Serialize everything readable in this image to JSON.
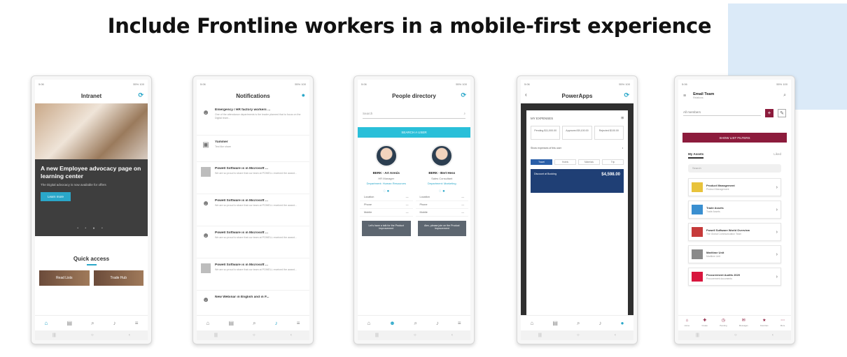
{
  "headline": "Include Frontline workers in a mobile-first experience",
  "phone1": {
    "status_time": "5:06",
    "status_right": "55% 100",
    "title": "Intranet",
    "hero_title": "A new Employee advocacy page on learning center",
    "hero_sub": "The Digital advocacy is now available for offers",
    "hero_button": "Learn more",
    "quick_access_title": "Quick access",
    "tiles": [
      "Read Lists",
      "Trade Hub"
    ]
  },
  "phone2": {
    "title": "Notifications",
    "items": [
      {
        "title": "Emergency / HR factory workers ...",
        "body": "One of the attendance departments is the leader planned that to focus on the Digital team..."
      },
      {
        "title": "Yammer",
        "body": "Test like share"
      },
      {
        "title": "Powell Software is in Microsoft ...",
        "body": "We are so proud to share that our team at POWELL received the award..."
      },
      {
        "title": "Powell Software is in Microsoft ...",
        "body": "We are so proud to share that our team at POWELL received the award..."
      },
      {
        "title": "Powell Software is in Microsoft ...",
        "body": "We are so proud to share that our team at POWELL received the award..."
      },
      {
        "title": "Powell Software is in Microsoft ...",
        "body": "We are so proud to share that our team at POWELL received the award..."
      },
      {
        "title": "New Webinar in English and in F...",
        "body": ""
      }
    ]
  },
  "phone3": {
    "title": "People directory",
    "search_placeholder": "Search",
    "bar_label": "SEARCH A USER",
    "people": [
      {
        "name": "BERK - Art Arenis",
        "role": "HR Manager",
        "link": "Department: Human Resources",
        "rows": [
          "Location",
          "Phone",
          "Mobile"
        ],
        "message": "Let's have a talk for the Product Improvement"
      },
      {
        "name": "BERK - Bert Hess",
        "role": "Sales Consultant",
        "link": "Department: Marketing",
        "rows": [
          "Location",
          "Phone",
          "Mobile"
        ],
        "message": "Alex, please join on the Product Improvement"
      }
    ]
  },
  "phone4": {
    "title": "PowerApps",
    "list_label": "MY EXPENSES",
    "boxes": [
      "Pending $11,000.00",
      "Approved $9,100.00",
      "Rejected $100.00"
    ],
    "filter_label": "Show expenses of this user",
    "tabs": [
      "Travel",
      "Hotels",
      "Materials",
      "Trip"
    ],
    "expense_title": "Discount at Booking",
    "expense_amount": "$4,598.00"
  },
  "phone5": {
    "title": "Email Team",
    "subtitle": "Relations",
    "dropdown": "All members",
    "filter_button": "SHOW LIST FILTERS",
    "tabs": [
      "My Assets",
      "Liked"
    ],
    "filter_placeholder": "Search",
    "items": [
      {
        "title": "Product Management",
        "sub": "Product Management",
        "thumb": "#e8c33c"
      },
      {
        "title": "Trade Assets",
        "sub": "Trade Assets",
        "thumb": "#3a8fd0"
      },
      {
        "title": "Powell Software World Overview",
        "sub": "The Global Communication Team",
        "thumb": "#c63a3a"
      },
      {
        "title": "Maritime Unit",
        "sub": "Maritime Unit",
        "thumb": "#8a8a8a"
      },
      {
        "title": "Procurement Audits 2020",
        "sub": "Procurement documents",
        "thumb": "#d8163d"
      }
    ],
    "nav": [
      "Home",
      "Create",
      "Pending",
      "Messages",
      "Favorites",
      "More"
    ]
  }
}
